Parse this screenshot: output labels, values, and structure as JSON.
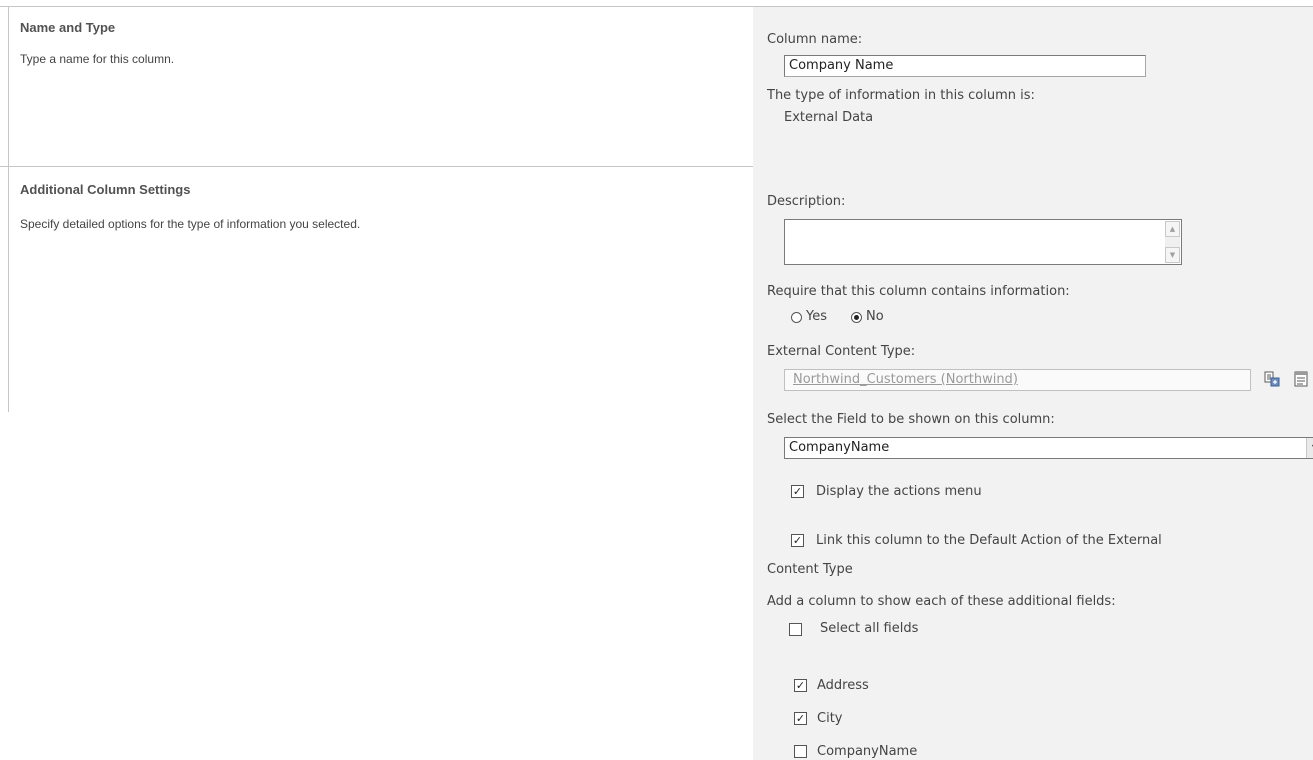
{
  "sections": {
    "name_type": {
      "title": "Name and Type",
      "description": "Type a name for this column."
    },
    "additional": {
      "title": "Additional Column Settings",
      "description": "Specify detailed options for the type of information you selected."
    }
  },
  "form": {
    "column_name_label": "Column name:",
    "column_name_value": "Company Name",
    "type_info_label": "The type of information in this column is:",
    "type_info_value": "External Data",
    "description_label": "Description:",
    "description_value": "",
    "require_label": "Require that this column contains information:",
    "require_options": [
      {
        "label": "Yes",
        "checked": false
      },
      {
        "label": "No",
        "checked": true
      }
    ],
    "ect_label": "External Content Type:",
    "ect_value": "Northwind_Customers (Northwind)",
    "select_field_label": "Select the Field to be shown on this column:",
    "select_field_value": "CompanyName",
    "display_actions_label": "Display the actions menu",
    "display_actions_checked": true,
    "link_default_line1": "Link this column to the Default Action of the External",
    "link_default_line2": "Content Type",
    "link_default_checked": true,
    "additional_fields_label": "Add a column to show each of these additional fields:",
    "select_all_label": "Select all fields",
    "select_all_checked": false,
    "fields": [
      {
        "label": "Address",
        "checked": true
      },
      {
        "label": "City",
        "checked": true
      },
      {
        "label": "CompanyName",
        "checked": false
      }
    ]
  },
  "icons": {
    "ect_browse": "external-content-type-picker-icon",
    "ect_refresh": "refresh-external-data-icon"
  }
}
